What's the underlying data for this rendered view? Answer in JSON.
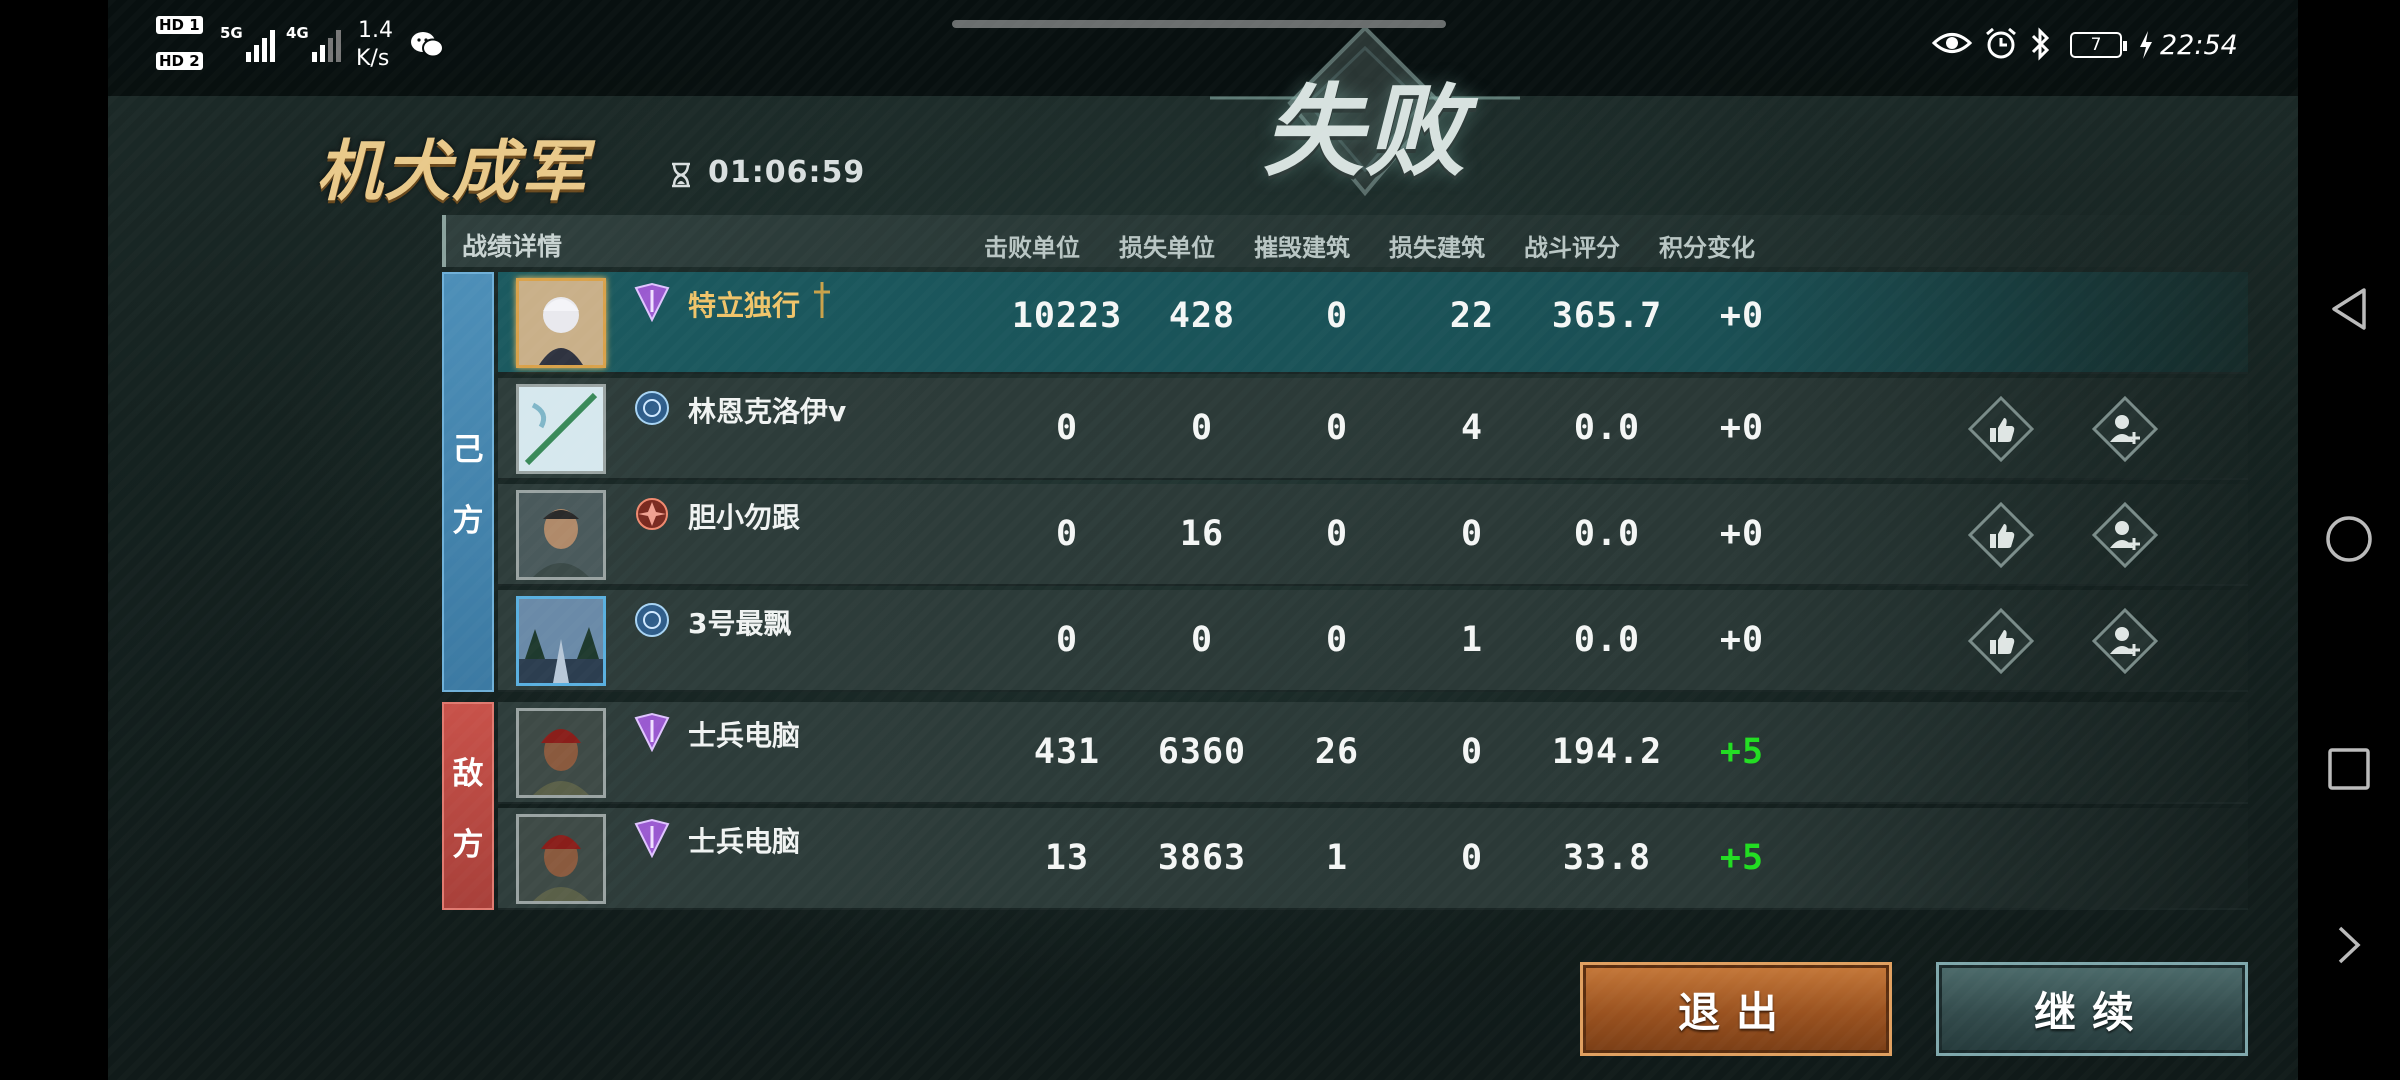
{
  "status_bar": {
    "hd1": "HD 1",
    "hd2": "HD 2",
    "net5g": "5G",
    "net4g": "4G",
    "speed_value": "1.4",
    "speed_unit": "K/s",
    "battery": "7",
    "time": "22:54"
  },
  "header": {
    "mode_title": "机犬成军",
    "timer": "01:06:59",
    "result": "失败"
  },
  "table": {
    "section_label": "战绩详情",
    "columns": [
      "击败单位",
      "损失单位",
      "摧毁建筑",
      "损失建筑",
      "战斗评分",
      "积分变化"
    ],
    "own_side_label": [
      "己",
      "方"
    ],
    "enemy_side_label": [
      "敌",
      "方"
    ],
    "own_rows": [
      {
        "name": "特立独行",
        "stats": [
          "10223",
          "428",
          "0",
          "22",
          "365.7",
          "+0"
        ],
        "rank_icon": "purple-rank-icon"
      },
      {
        "name": "林恩克洛伊v",
        "stats": [
          "0",
          "0",
          "0",
          "4",
          "0.0",
          "+0"
        ],
        "rank_icon": "blue-globe-rank-icon"
      },
      {
        "name": "胆小勿跟",
        "stats": [
          "0",
          "16",
          "0",
          "0",
          "0.0",
          "+0"
        ],
        "rank_icon": "red-rank-icon"
      },
      {
        "name": "3号最飘",
        "stats": [
          "0",
          "0",
          "0",
          "1",
          "0.0",
          "+0"
        ],
        "rank_icon": "blue-globe-rank-icon"
      }
    ],
    "enemy_rows": [
      {
        "name": "士兵电脑",
        "stats": [
          "431",
          "6360",
          "26",
          "0",
          "194.2",
          "+5"
        ],
        "rank_icon": "purple-rank-icon"
      },
      {
        "name": "士兵电脑",
        "stats": [
          "13",
          "3863",
          "1",
          "0",
          "33.8",
          "+5"
        ],
        "rank_icon": "purple-rank-icon"
      }
    ]
  },
  "buttons": {
    "exit": "退出",
    "continue": "继续"
  },
  "colors": {
    "accent_gold": "#e9c98a",
    "own_side": "#4d8fb8",
    "enemy_side": "#c8524a",
    "positive_score": "#22dd22"
  }
}
